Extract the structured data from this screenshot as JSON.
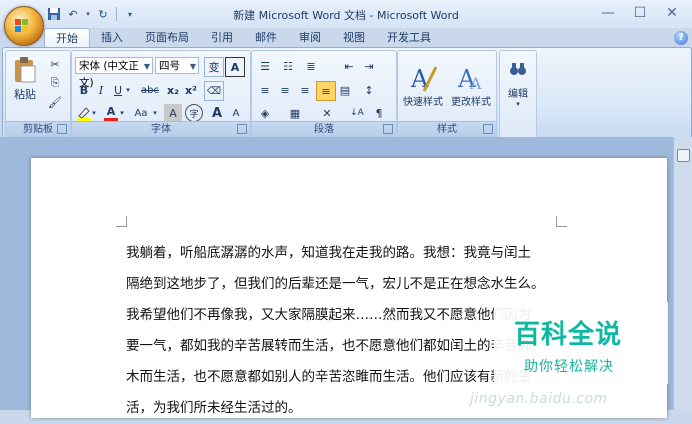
{
  "title": "新建 Microsoft Word 文档 - Microsoft Word",
  "tabs": [
    "开始",
    "插入",
    "页面布局",
    "引用",
    "邮件",
    "审阅",
    "视图",
    "开发工具"
  ],
  "groups": {
    "clipboard": {
      "label": "剪贴板",
      "paste": "粘贴"
    },
    "font": {
      "label": "字体",
      "font_name": "宋体 (中文正文)",
      "font_size": "四号"
    },
    "paragraph": {
      "label": "段落"
    },
    "styles": {
      "label": "样式",
      "quick": "快速样式",
      "change": "更改样式"
    },
    "editing": {
      "label": "编辑"
    }
  },
  "glyphs": {
    "wen": "变",
    "a_box": "A",
    "bold": "B",
    "italic": "I",
    "underline": "U",
    "strike": "abc",
    "sub": "x₂",
    "sup": "x²",
    "font_color": "A",
    "aa": "Aa",
    "char_shade": "A",
    "enclose": "字",
    "grow": "A",
    "shrink": "A",
    "sort": "↓A",
    "pilcrow": "¶",
    "find": "A"
  },
  "document": {
    "lines": [
      "我躺着，听船底潺潺的水声，知道我在走我的路。我想：我竟与闰土",
      "隔绝到这地步了，但我们的后辈还是一气，宏儿不是正在想念水生么。",
      "我希望他们不再像我，又大家隔膜起来……然而我又不愿意他们因为",
      "要一气，都如我的辛苦展转而生活，也不愿意他们都如闰土的辛苦麻",
      "木而生活，也不愿意都如别人的辛苦恣睢而生活。他们应该有新的生",
      "活，为我们所未经生活过的。"
    ]
  },
  "watermark": {
    "title": "百科全说",
    "subtitle": "助你轻松解决",
    "url": "jingyan.baidu.com"
  },
  "colors": {
    "ribbon": "#dde9f8",
    "accent": "#2a5ba6",
    "watermark": "#0fb8a0"
  }
}
